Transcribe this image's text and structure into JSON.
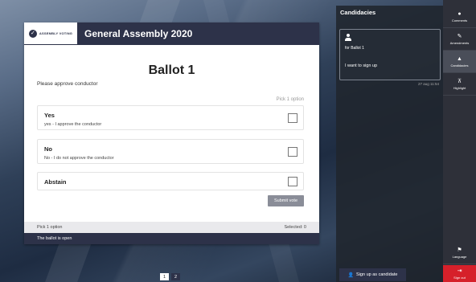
{
  "app": {
    "logo_text": "Assembly Voting",
    "title": "General Assembly 2020"
  },
  "ballot": {
    "title": "Ballot 1",
    "description": "Please approve conductor",
    "pick_label": "Pick 1 option",
    "options": [
      {
        "title": "Yes",
        "description": "yes - I approve the conductor"
      },
      {
        "title": "No",
        "description": "No - I do not approve the conductor"
      },
      {
        "title": "Abstain",
        "description": ""
      }
    ],
    "submit_label": "Submit vote",
    "footer_left": "Pick 1 option",
    "footer_right": "Selected: 0",
    "status": "The ballot is open"
  },
  "pagination": {
    "pages": [
      "1",
      "2"
    ],
    "active": "1"
  },
  "candidacies": {
    "title": "Candidacies",
    "item": {
      "for": "for Ballot 1",
      "message": "I want to sign up",
      "timestamp": "27 aug 11:54"
    },
    "signup_label": "Sign up as candidate"
  },
  "sidebar": {
    "items": [
      {
        "label": "Comments",
        "icon": "comment-icon"
      },
      {
        "label": "Amendments",
        "icon": "amendment-icon"
      },
      {
        "label": "Candidacies",
        "icon": "user-icon"
      },
      {
        "label": "Highlight",
        "icon": "pin-icon"
      }
    ],
    "language_label": "Language",
    "signout_label": "Sign out"
  },
  "colors": {
    "brand": "#2d3249",
    "signout": "#d6202a",
    "submit": "#8a8d98"
  }
}
